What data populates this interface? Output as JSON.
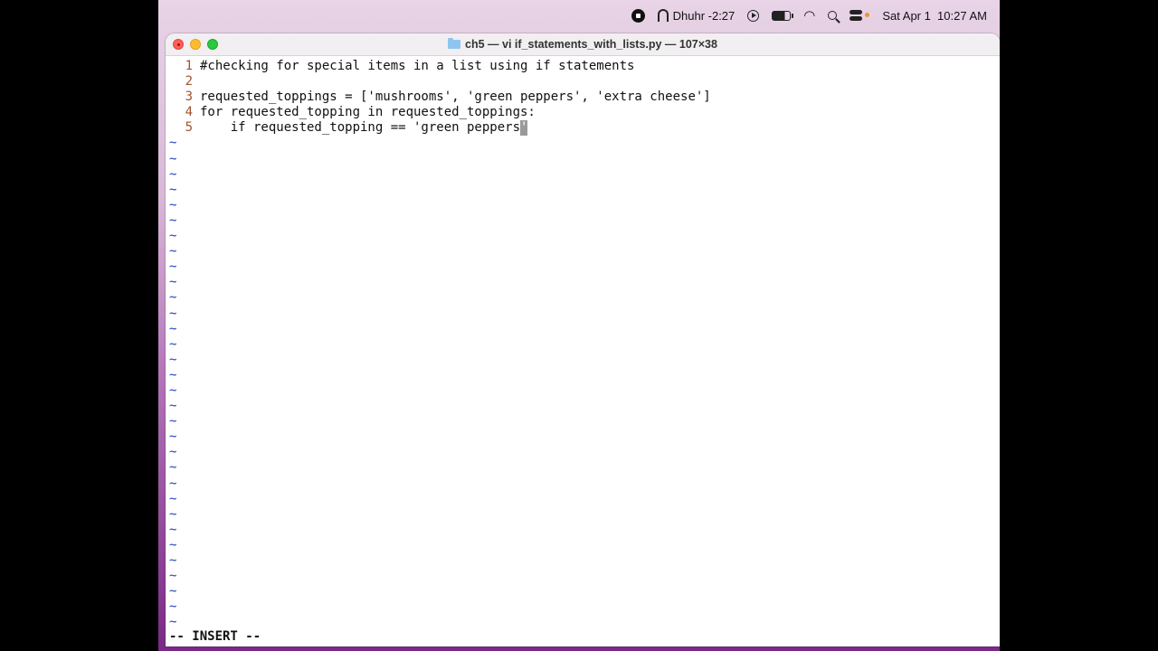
{
  "menubar": {
    "prayer": "Dhuhr -2:27",
    "datetime": "Sat Apr 1  10:27 AM",
    "icons": [
      "screen-record-icon",
      "prayer-time-icon",
      "play-icon",
      "battery-icon",
      "wifi-icon",
      "search-icon",
      "control-center-icon"
    ]
  },
  "window": {
    "title": "ch5 — vi if_statements_with_lists.py — 107×38"
  },
  "editor": {
    "lines": [
      {
        "num": "1",
        "text": "#checking for special items in a list using if statements"
      },
      {
        "num": "2",
        "text": ""
      },
      {
        "num": "3",
        "text": "requested_toppings = ['mushrooms', 'green peppers', 'extra cheese']"
      },
      {
        "num": "4",
        "text": "for requested_topping in requested_toppings:"
      },
      {
        "num": "5",
        "text": "    if requested_topping == 'green peppers",
        "cursor_char": "'"
      }
    ],
    "tilde": "~",
    "mode": "-- INSERT --"
  }
}
